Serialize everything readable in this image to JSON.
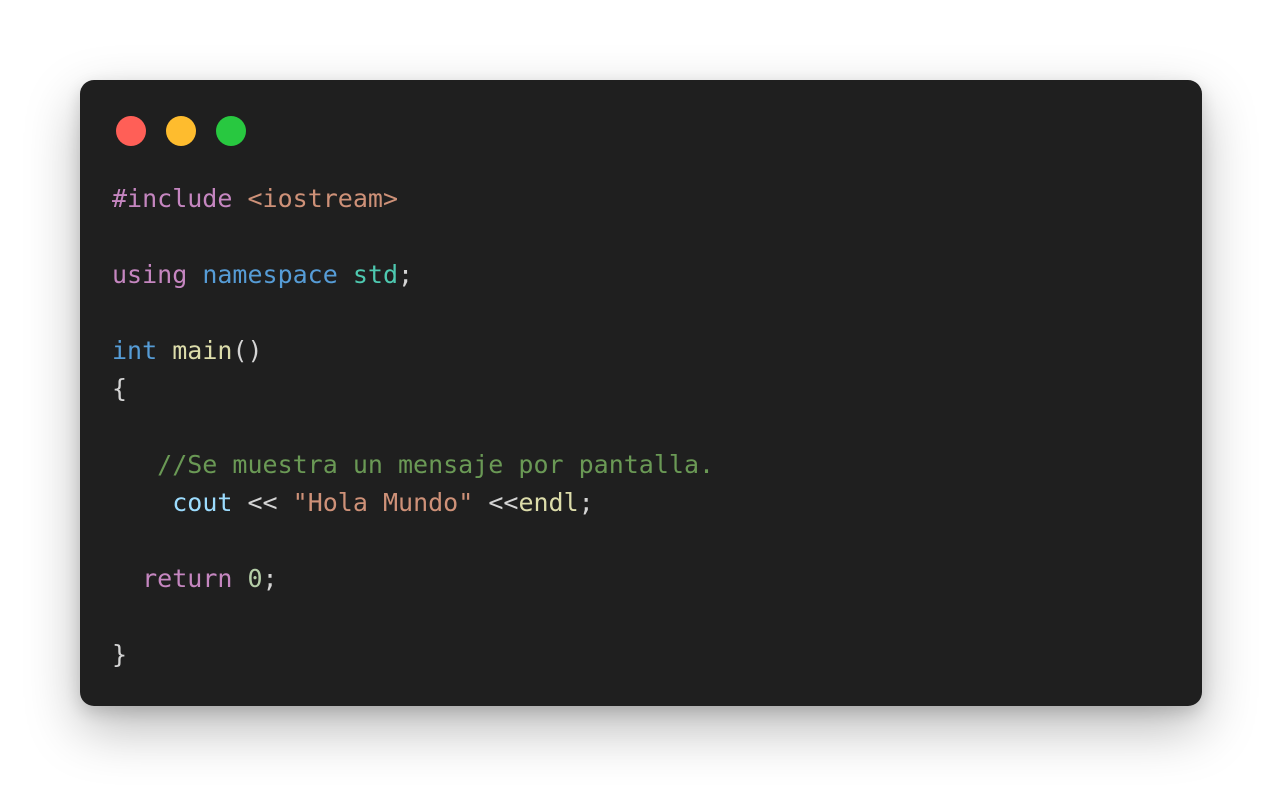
{
  "window": {
    "controls": [
      {
        "name": "close",
        "color": "#ff5f57"
      },
      {
        "name": "minimize",
        "color": "#febc2e"
      },
      {
        "name": "maximize",
        "color": "#28c840"
      }
    ],
    "background": "#1f1f1f"
  },
  "code": {
    "language": "cpp",
    "lines": [
      [
        {
          "t": "#include",
          "k": "preproc"
        },
        {
          "t": " ",
          "k": "punct"
        },
        {
          "t": "<iostream>",
          "k": "include"
        }
      ],
      [],
      [
        {
          "t": "using",
          "k": "keyword"
        },
        {
          "t": " ",
          "k": "punct"
        },
        {
          "t": "namespace",
          "k": "storage"
        },
        {
          "t": " ",
          "k": "punct"
        },
        {
          "t": "std",
          "k": "ns"
        },
        {
          "t": ";",
          "k": "punct"
        }
      ],
      [],
      [
        {
          "t": "int",
          "k": "storage"
        },
        {
          "t": " ",
          "k": "punct"
        },
        {
          "t": "main",
          "k": "func"
        },
        {
          "t": "()",
          "k": "punct"
        }
      ],
      [
        {
          "t": "{",
          "k": "punct"
        }
      ],
      [],
      [
        {
          "t": "   ",
          "k": "punct"
        },
        {
          "t": "//Se muestra un mensaje por pantalla.",
          "k": "comment"
        }
      ],
      [
        {
          "t": "    ",
          "k": "punct"
        },
        {
          "t": "cout",
          "k": "var"
        },
        {
          "t": " << ",
          "k": "op"
        },
        {
          "t": "\"Hola Mundo\"",
          "k": "string"
        },
        {
          "t": " <<",
          "k": "op"
        },
        {
          "t": "endl",
          "k": "func"
        },
        {
          "t": ";",
          "k": "punct"
        }
      ],
      [],
      [
        {
          "t": "  ",
          "k": "punct"
        },
        {
          "t": "return",
          "k": "keyword"
        },
        {
          "t": " ",
          "k": "punct"
        },
        {
          "t": "0",
          "k": "number"
        },
        {
          "t": ";",
          "k": "punct"
        }
      ],
      [],
      [
        {
          "t": "}",
          "k": "punct"
        }
      ]
    ]
  }
}
